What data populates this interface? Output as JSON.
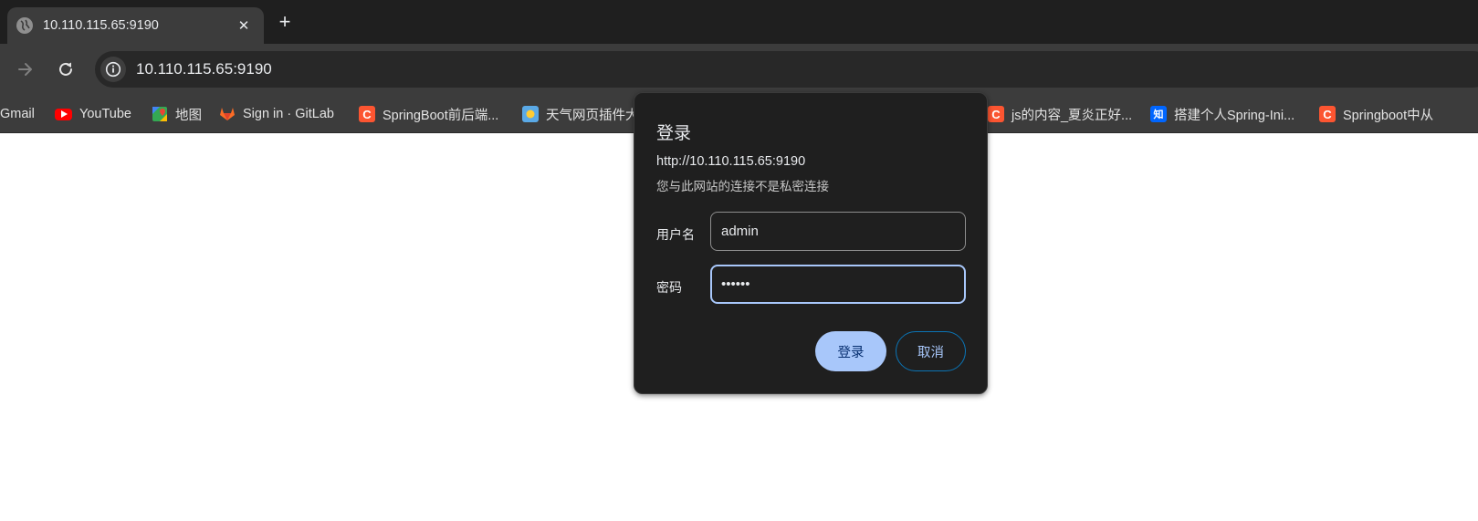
{
  "tab": {
    "title": "10.110.115.65:9190",
    "close_glyph": "✕",
    "favicon": "globe-icon"
  },
  "new_tab_glyph": "+",
  "omnibox": {
    "url": "10.110.115.65:9190"
  },
  "bookmarks": [
    {
      "label": "Gmail",
      "icon": "gmail-icon"
    },
    {
      "label": "YouTube",
      "icon": "youtube-icon"
    },
    {
      "label": "地图",
      "icon": "maps-icon"
    },
    {
      "label": "Sign in · GitLab",
      "icon": "gitlab-icon"
    },
    {
      "label": "SpringBoot前后端...",
      "icon": "csdn-icon",
      "icon_glyph": "C"
    },
    {
      "label": "天气网页插件大",
      "icon": "weather-icon"
    },
    {
      "label": "js的内容_夏炎正好...",
      "icon": "csdn-icon",
      "icon_glyph": "C"
    },
    {
      "label": "搭建个人Spring-Ini...",
      "icon": "zhihu-icon",
      "icon_glyph": "知"
    },
    {
      "label": "Springboot中从",
      "icon": "csdn-icon",
      "icon_glyph": "C"
    }
  ],
  "dialog": {
    "title": "登录",
    "origin": "http://10.110.115.65:9190",
    "warning": "您与此网站的连接不是私密连接",
    "username_label": "用户名",
    "username_value": "admin",
    "password_label": "密码",
    "password_value": "••••••",
    "submit_label": "登录",
    "cancel_label": "取消"
  },
  "colors": {
    "accent": "#a8c7fa",
    "dialog_bg": "#1f1f1f",
    "toolbar_bg": "#3c3c3c",
    "tabstrip_bg": "#1f1f1f"
  }
}
